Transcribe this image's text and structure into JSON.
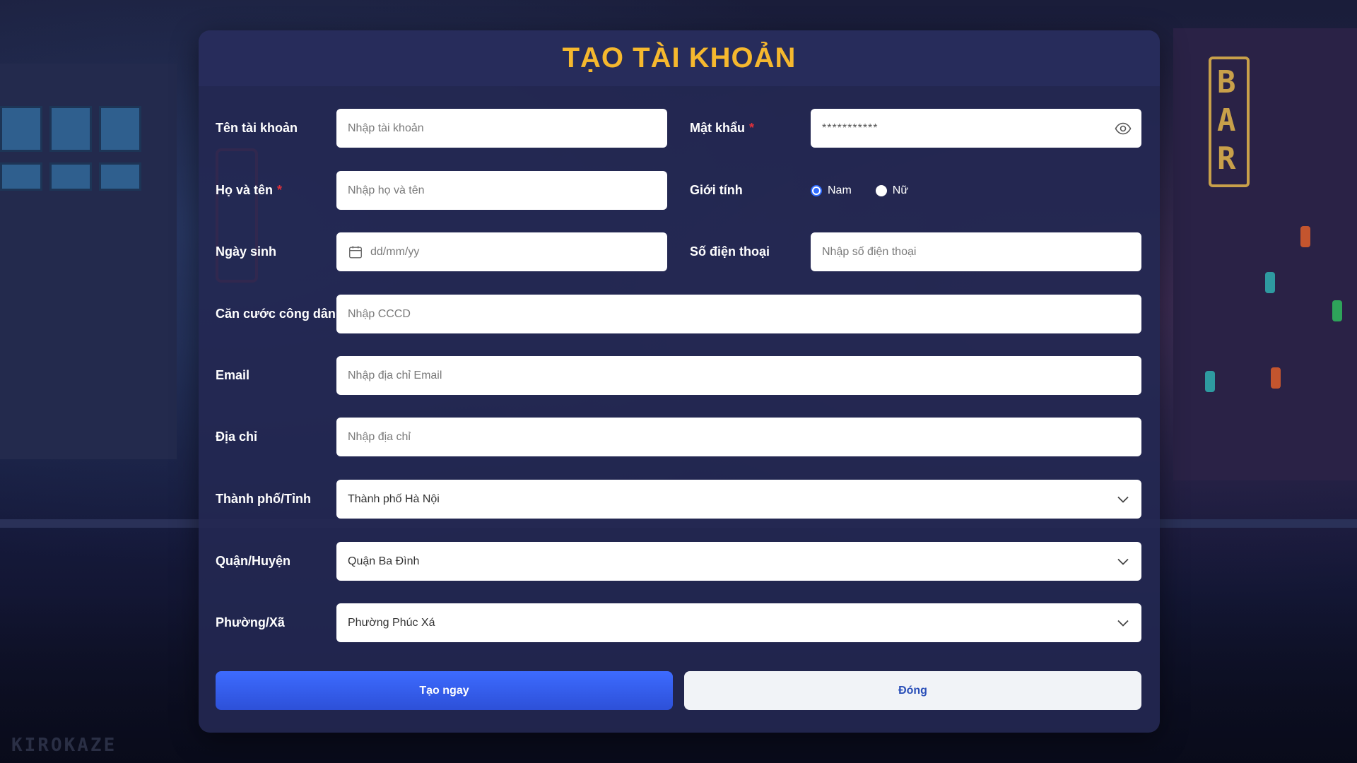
{
  "form": {
    "title": "TẠO TÀI KHOẢN",
    "required_mark": "*",
    "username": {
      "label": "Tên tài khoản",
      "placeholder": "Nhập tài khoản",
      "value": ""
    },
    "password": {
      "label": "Mật khẩu",
      "value": "***********"
    },
    "fullname": {
      "label": "Họ và tên",
      "placeholder": "Nhập họ và tên",
      "value": ""
    },
    "gender": {
      "label": "Giới tính",
      "options": [
        {
          "label": "Nam",
          "checked": true
        },
        {
          "label": "Nữ",
          "checked": false
        }
      ]
    },
    "birthdate": {
      "label": "Ngày sinh",
      "placeholder": "dd/mm/yy"
    },
    "phone": {
      "label": "Số điện thoại",
      "placeholder": "Nhập số điện thoại",
      "value": ""
    },
    "id_card": {
      "label": "Căn cước công dân",
      "placeholder": "Nhập CCCD",
      "value": ""
    },
    "email": {
      "label": "Email",
      "placeholder": "Nhập địa chỉ Email",
      "value": ""
    },
    "address": {
      "label": "Địa chỉ",
      "placeholder": "Nhập địa chỉ",
      "value": ""
    },
    "city": {
      "label": "Thành phố/Tỉnh",
      "selected": "Thành phố Hà Nội"
    },
    "district": {
      "label": "Quận/Huyện",
      "selected": "Quận Ba Đình"
    },
    "ward": {
      "label": "Phường/Xã",
      "selected": "Phường Phúc Xá"
    },
    "submit_label": "Tạo ngay",
    "close_label": "Đóng"
  },
  "background": {
    "watermark": "KIROKAZE",
    "sign_text": "BAR"
  },
  "colors": {
    "title": "#f5b82e",
    "required": "#e0303a",
    "primary": "#3d6bff",
    "radio_checked": "#2f6bff",
    "secondary_text": "#2a4fb8"
  }
}
